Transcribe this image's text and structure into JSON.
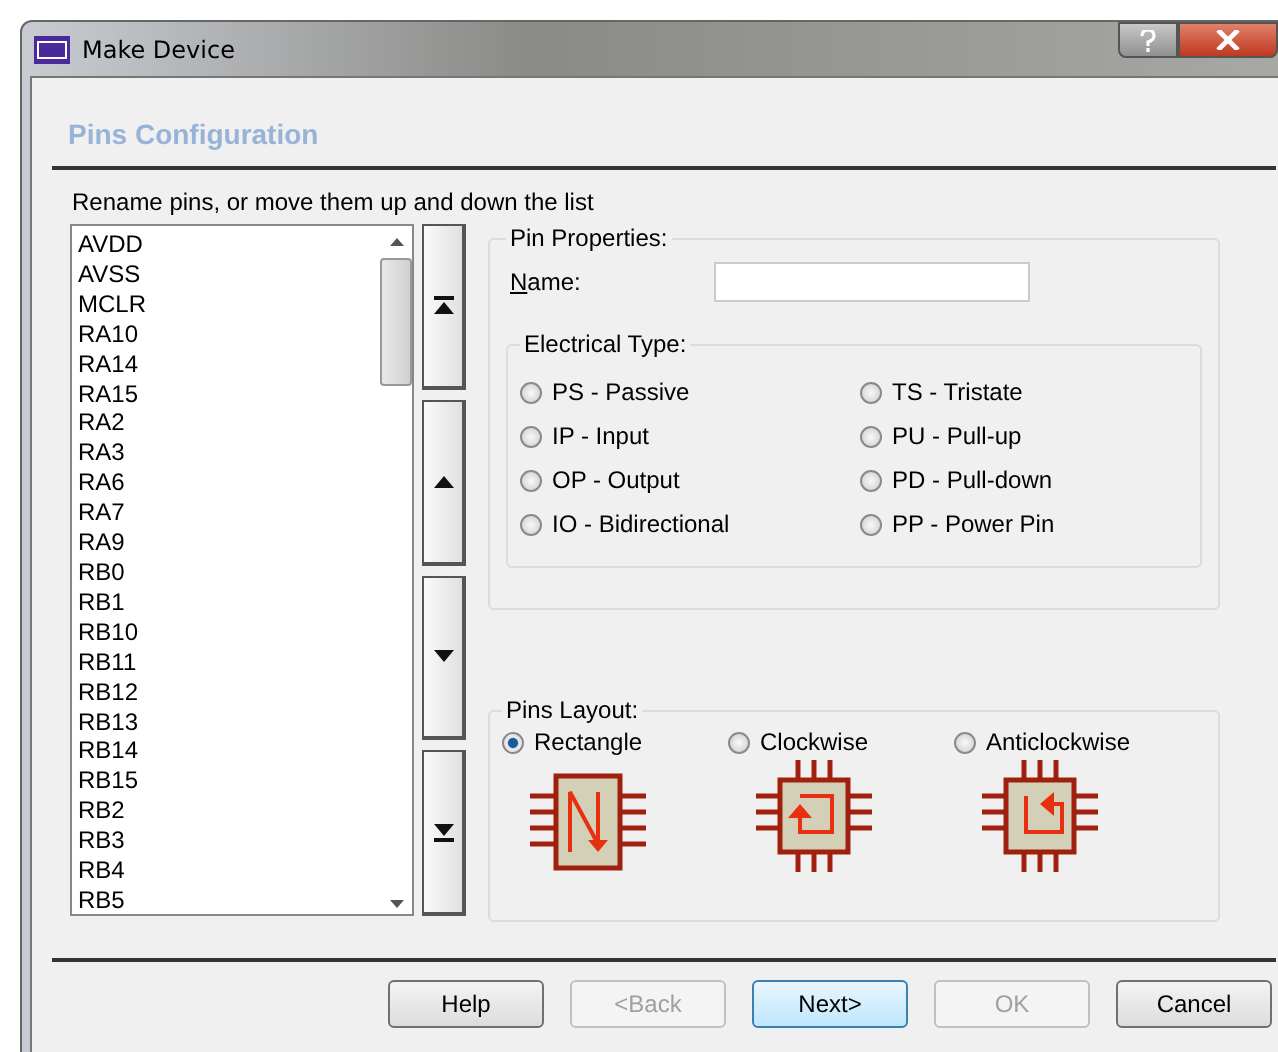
{
  "window": {
    "title": "Make Device"
  },
  "header": "Pins Configuration",
  "instruction": "Rename pins, or move them up and down the list",
  "pins": [
    "AVDD",
    "AVSS",
    "MCLR",
    "RA10",
    "RA14",
    "RA15",
    "RA2",
    "RA3",
    "RA6",
    "RA7",
    "RA9",
    "RB0",
    "RB1",
    "RB10",
    "RB11",
    "RB12",
    "RB13",
    "RB14",
    "RB15",
    "RB2",
    "RB3",
    "RB4",
    "RB5"
  ],
  "move_buttons": [
    {
      "kind": "top"
    },
    {
      "kind": "up"
    },
    {
      "kind": "down"
    },
    {
      "kind": "bottom"
    }
  ],
  "pin_properties": {
    "title": "Pin Properties:",
    "name_label": "Name:",
    "electrical_title": "Electrical Type:",
    "types": [
      {
        "label": "PS - Passive",
        "selected": false
      },
      {
        "label": "IP - Input",
        "selected": false
      },
      {
        "label": "OP - Output",
        "selected": false
      },
      {
        "label": "IO - Bidirectional",
        "selected": false
      },
      {
        "label": "TS - Tristate",
        "selected": false
      },
      {
        "label": "PU - Pull-up",
        "selected": false
      },
      {
        "label": "PD - Pull-down",
        "selected": false
      },
      {
        "label": "PP - Power Pin",
        "selected": false
      }
    ]
  },
  "pins_layout": {
    "title": "Pins Layout:",
    "options": [
      {
        "label": "Rectangle",
        "kind": "rectangle",
        "selected": true
      },
      {
        "label": "Clockwise",
        "kind": "clockwise",
        "selected": false
      },
      {
        "label": "Anticlockwise",
        "kind": "anticlockwise",
        "selected": false
      }
    ]
  },
  "buttons": [
    {
      "label": "Help",
      "disabled": false,
      "default": false
    },
    {
      "label": "<Back",
      "disabled": true,
      "default": false
    },
    {
      "label": "Next>",
      "disabled": false,
      "default": true
    },
    {
      "label": "OK",
      "disabled": true,
      "default": false
    },
    {
      "label": "Cancel",
      "disabled": false,
      "default": false
    }
  ]
}
